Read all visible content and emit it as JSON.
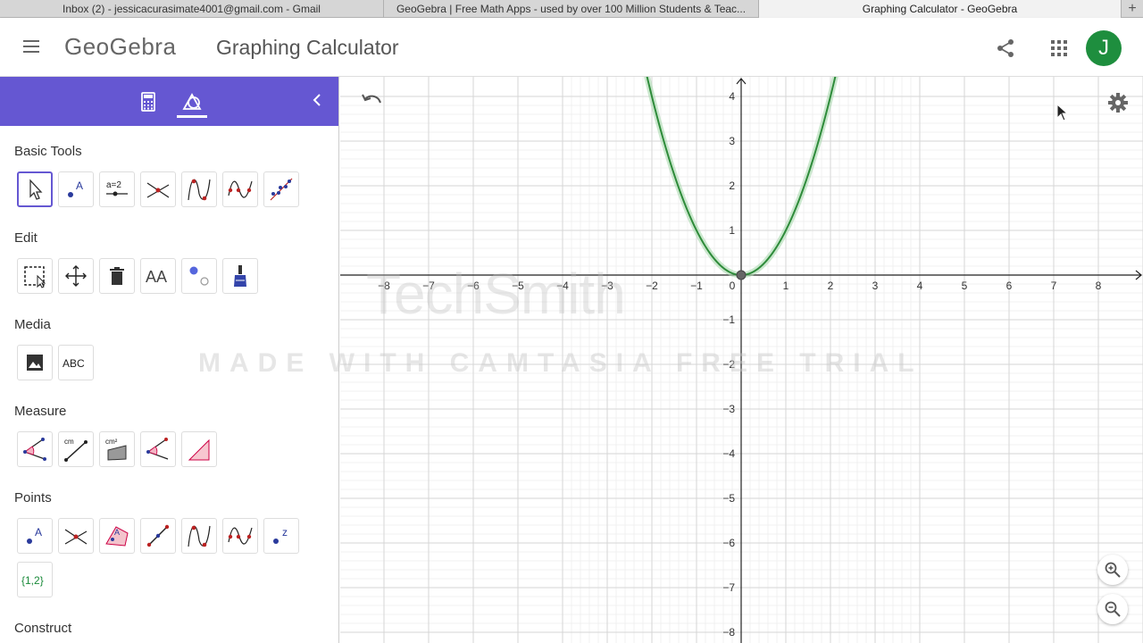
{
  "browser": {
    "tabs": [
      {
        "title": "Inbox (2) - jessicacurasimate4001@gmail.com - Gmail",
        "active": false
      },
      {
        "title": "GeoGebra | Free Math Apps - used by over 100 Million Students & Teac...",
        "active": false
      },
      {
        "title": "Graphing Calculator - GeoGebra",
        "active": true
      }
    ],
    "new_tab": "+"
  },
  "header": {
    "logo": "GeoGebra",
    "title": "Graphing Calculator",
    "avatar_initial": "J",
    "icons": [
      "menu-icon",
      "share-icon",
      "apps-grid-icon"
    ]
  },
  "panel": {
    "tabs": [
      "calculator-icon",
      "tools-icon"
    ],
    "active_tab": "tools",
    "accent": "#6557d2",
    "sections": [
      {
        "title": "Basic Tools",
        "tools": [
          "move",
          "point",
          "slider",
          "intersect",
          "extremum",
          "roots",
          "best-fit-line"
        ]
      },
      {
        "title": "Edit",
        "tools": [
          "select-objects",
          "move-graphics-view",
          "delete",
          "show-hide-label",
          "show-hide-object",
          "copy-visual-style"
        ]
      },
      {
        "title": "Media",
        "tools": [
          "image",
          "text"
        ]
      },
      {
        "title": "Measure",
        "tools": [
          "angle",
          "distance-length",
          "area",
          "angle-with-given-size",
          "slope"
        ]
      },
      {
        "title": "Points",
        "tools": [
          "point",
          "intersect",
          "point-on-object",
          "midpoint",
          "extremum",
          "roots",
          "complex-number",
          "list"
        ]
      },
      {
        "title": "Construct",
        "tools": []
      }
    ],
    "tool_text": {
      "slider": "a=2",
      "text": "ABC",
      "show_hide_label": "AA",
      "distance": "cm",
      "area": "cm²",
      "list": "{1,2}",
      "point_label": "A",
      "complex_label": "z"
    }
  },
  "graphics": {
    "x_ticks": [
      "−8",
      "−7",
      "−6",
      "−5",
      "−4",
      "−3",
      "−2",
      "−1",
      "0",
      "1",
      "2",
      "3",
      "4",
      "5",
      "6",
      "7",
      "8"
    ],
    "y_ticks": [
      "4",
      "3",
      "2",
      "1",
      "−1",
      "−2",
      "−3",
      "−4",
      "−5",
      "−6",
      "−7",
      "−8"
    ],
    "function": "y = x²",
    "curve_color": "#2e8b3a",
    "axes_color": "#222222"
  },
  "watermark": {
    "logo": "TechSmith",
    "line": "MADE WITH CAMTASIA FREE TRIAL"
  }
}
